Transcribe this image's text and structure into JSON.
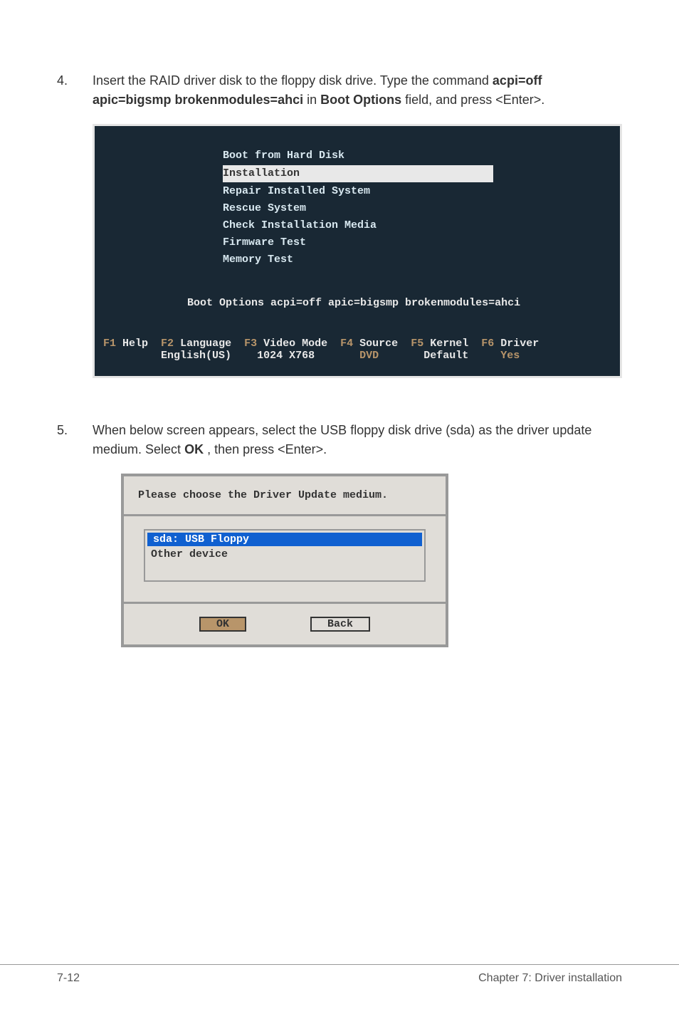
{
  "steps": {
    "step4": {
      "number": "4.",
      "text_prefix": "Insert the RAID driver disk to the floppy disk drive. Type the command ",
      "bold1": "acpi=off apic=bigsmp brokenmodules=ahci",
      "mid1": " in ",
      "bold2": "Boot Options",
      "suffix": " field, and press <Enter>."
    },
    "step5": {
      "number": "5.",
      "text_prefix": "When below screen appears, select the USB floppy disk drive (sda) as the driver update medium. Select ",
      "bold1": "OK",
      "suffix": ", then press <Enter>."
    }
  },
  "boot_menu": {
    "items": [
      "Boot from Hard Disk",
      "Installation",
      "Repair Installed System",
      "Rescue System",
      "Check Installation Media",
      "Firmware Test",
      "Memory Test"
    ],
    "selected_index": 1,
    "options_line": "Boot Options acpi=off apic=bigsmp brokenmodules=ahci",
    "footer": [
      {
        "key": "F1",
        "label": "Help",
        "value": ""
      },
      {
        "key": "F2",
        "label": "Language",
        "value": "English(US)"
      },
      {
        "key": "F3",
        "label": "Video Mode",
        "value": "1024 X768"
      },
      {
        "key": "F4",
        "label": "Source",
        "value": "DVD",
        "gold": true
      },
      {
        "key": "F5",
        "label": "Kernel",
        "value": "Default"
      },
      {
        "key": "F6",
        "label": "Driver",
        "value": "Yes",
        "gold": true
      }
    ]
  },
  "dialog": {
    "title": "Please choose the Driver Update medium.",
    "devices": [
      {
        "label": "sda: USB Floppy",
        "selected": true
      },
      {
        "label": "Other device",
        "selected": false
      }
    ],
    "ok": "OK",
    "back": "Back"
  },
  "footer": {
    "page": "7-12",
    "chapter": "Chapter 7: Driver installation"
  }
}
